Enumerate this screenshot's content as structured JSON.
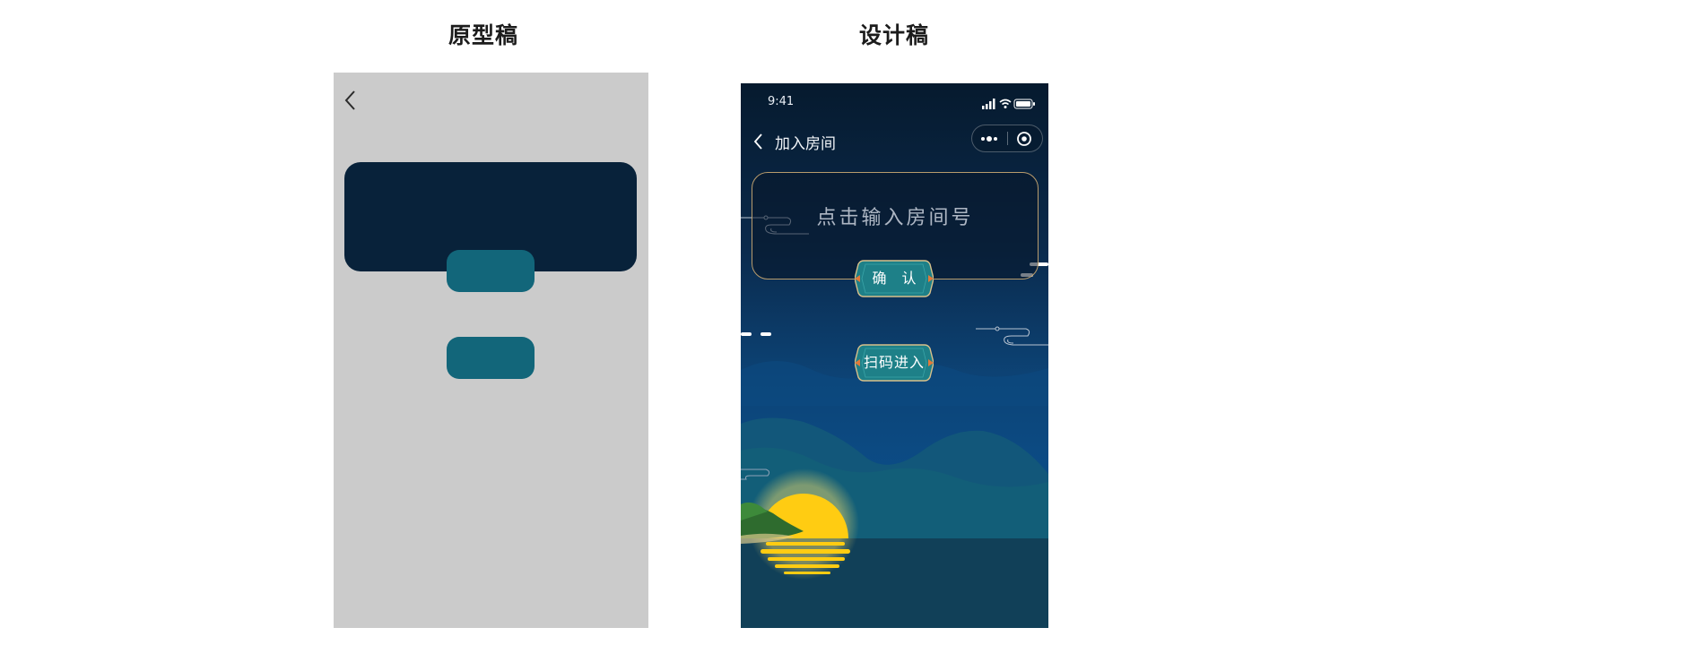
{
  "headings": {
    "prototype": "原型稿",
    "design": "设计稿"
  },
  "design": {
    "status_bar": {
      "time": "9:41",
      "icons": [
        "signal-icon",
        "wifi-icon",
        "battery-icon"
      ]
    },
    "navbar": {
      "back_icon": "chevron-left-icon",
      "title": "加入房间",
      "capsule_icons": [
        "more-icon",
        "target-icon"
      ]
    },
    "room_input": {
      "placeholder": "点击输入房间号"
    },
    "confirm_button": {
      "label": "确 认"
    },
    "scan_button": {
      "label": "扫码进入"
    }
  },
  "colors": {
    "prototype_background": "#cbcbcb",
    "prototype_card": "#08223a",
    "prototype_button": "#12667a",
    "design_accent_teal": "#1f8a93",
    "design_border_gold": "#b89b6c",
    "moon": "#ffcc12"
  }
}
